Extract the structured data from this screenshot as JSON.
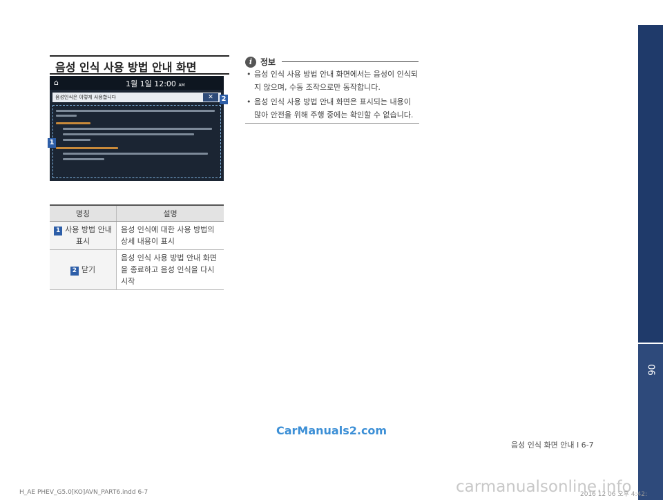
{
  "section_title": "음성 인식 사용 방법 안내 화면",
  "screen": {
    "date_time": "1월  1일  12:00",
    "am_pm": "AM",
    "header_text": "음성인식은 이렇게 사용합니다",
    "close_label": "✕"
  },
  "callouts": {
    "c1": "1",
    "c2": "2"
  },
  "table": {
    "headers": [
      "명칭",
      "설명"
    ],
    "rows": [
      {
        "num": "1",
        "name": "사용 방법 안내 표시",
        "desc": "음성 인식에 대한 사용 방법의 상세 내용이 표시"
      },
      {
        "num": "2",
        "name": "닫기",
        "desc": "음성 인식 사용 방법 안내 화면을 종료하고 음성 인식을 다시 시작"
      }
    ]
  },
  "info": {
    "icon": "i",
    "title": "정보",
    "items": [
      "음성 인식 사용 방법 안내 화면에서는 음성이 인식되지 않으며, 수동 조작으로만 동작합니다.",
      "음성 인식 사용 방법 안내 화면은 표시되는 내용이 많아 안전을 위해 주행 중에는 확인할 수 없습니다."
    ]
  },
  "side_tab_number": "06",
  "page_footer": "음성 인식 화면 안내 I 6-7",
  "watermark": "CarManuals2.com",
  "indd_info": "H_AE PHEV_G5.0[KO]AVN_PART6.indd   6-7",
  "watermark2": "carmanualsonline.info",
  "timestamp": "2016 12 06   오후 4:42:"
}
